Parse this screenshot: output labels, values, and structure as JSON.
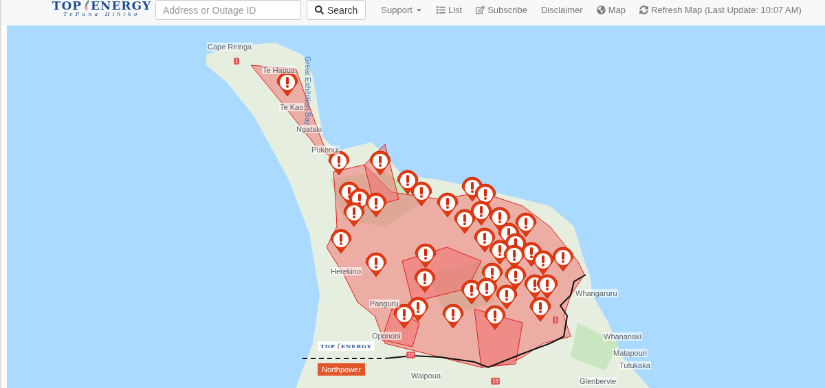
{
  "header": {
    "logo": {
      "left": "TOP",
      "right": "ENERGY",
      "tagline": "TePuna Hihiko"
    },
    "search": {
      "placeholder": "Address or Outage ID",
      "button": "Search"
    },
    "nav": [
      {
        "label": "Support",
        "kind": "dropdown"
      },
      {
        "label": "List",
        "kind": "list"
      },
      {
        "label": "Subscribe",
        "kind": "edit"
      },
      {
        "label": "Disclaimer",
        "kind": "plain"
      },
      {
        "label": "Map",
        "kind": "globe"
      },
      {
        "label": "Refresh Map (Last Update: 10:07 AM)",
        "kind": "refresh"
      }
    ]
  },
  "map": {
    "place_labels": [
      {
        "text": "Cape Reinga"
      },
      {
        "text": "Te Hapua"
      },
      {
        "text": "Great Exhibition Bay",
        "kind": "water"
      },
      {
        "text": "Te Kao"
      },
      {
        "text": "Ngataki"
      },
      {
        "text": "Pukenui"
      },
      {
        "text": "Herekino"
      },
      {
        "text": "Panguru"
      },
      {
        "text": "Opononi"
      },
      {
        "text": "Waipoua"
      },
      {
        "text": "Whangaruru"
      },
      {
        "text": "Whananaki"
      },
      {
        "text": "Matapouri"
      },
      {
        "text": "Tutukaka"
      },
      {
        "text": "Glenbervie"
      }
    ],
    "road_shields": [
      "1",
      "1",
      "12",
      "15"
    ],
    "legend": [
      {
        "kind": "logo",
        "left": "TOP",
        "right": "ENERGY"
      },
      {
        "kind": "tag",
        "text": "Northpower"
      }
    ]
  }
}
